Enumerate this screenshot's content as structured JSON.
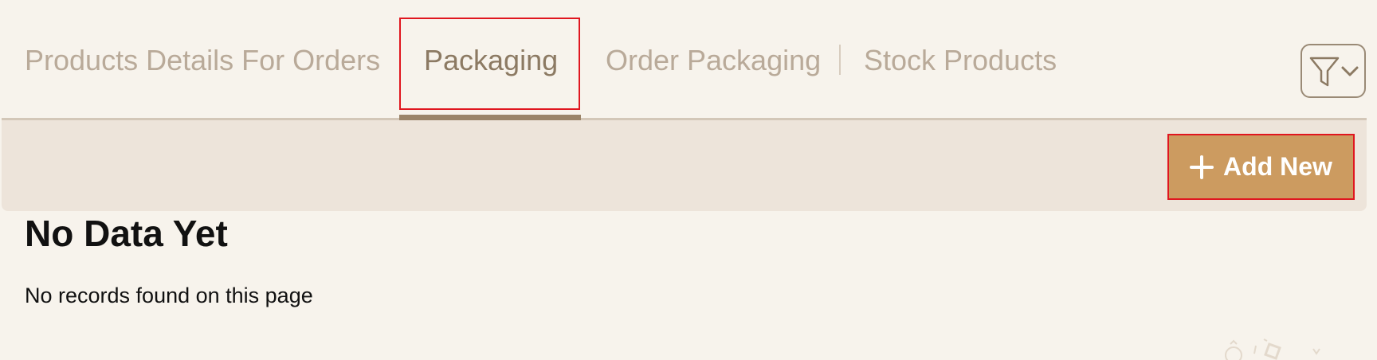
{
  "tabs": [
    {
      "label": "Products Details For Orders",
      "active": false
    },
    {
      "label": "Packaging",
      "active": true
    },
    {
      "label": "Order Packaging",
      "active": false
    },
    {
      "label": "Stock Products",
      "active": false
    }
  ],
  "filter": {
    "icon": "filter-icon",
    "dropdown_icon": "chevron-down-icon"
  },
  "toolbar": {
    "add_new_label": "Add New",
    "add_new_icon": "plus-icon"
  },
  "empty_state": {
    "title": "No Data Yet",
    "message": "No records found on this page"
  },
  "colors": {
    "background": "#f7f3ec",
    "toolbar_background": "#ede4da",
    "tab_inactive": "#b9aa99",
    "tab_active": "#8c7a63",
    "active_underline": "#9b8469",
    "accent_button": "#cc9b60",
    "highlight_border": "#e0161f"
  }
}
